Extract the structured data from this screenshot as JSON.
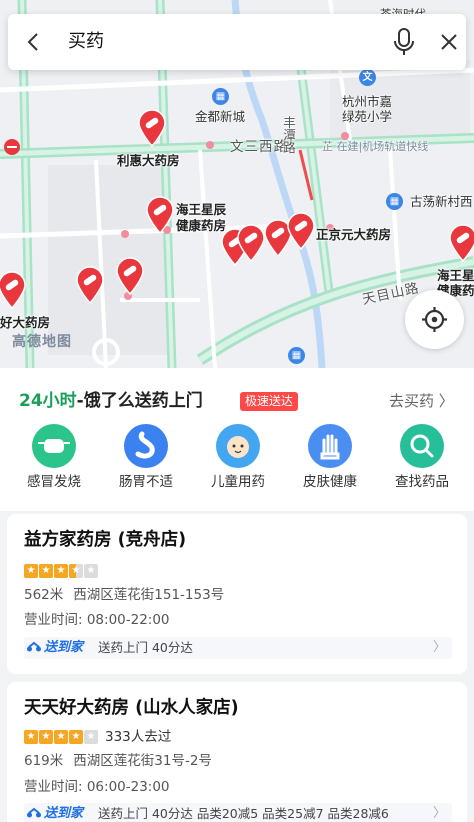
{
  "search": {
    "query": "买药"
  },
  "map": {
    "road_labels": [
      "文三西路",
      "丰潭路",
      "天目山路",
      "古荡新村西"
    ],
    "place_labels": [
      "金都新城",
      "杭州市嘉",
      "绿苑小学",
      "芷 在建|机场轨道快线",
      "茶海时代"
    ],
    "pois": [
      {
        "name": "利惠大药房"
      },
      {
        "name_line1": "海王星辰",
        "name_line2": "健康药房"
      },
      {
        "name": "正京元大药房"
      },
      {
        "name_line1": "海王星",
        "name_line2": "健康药"
      },
      {
        "name": "好大药房"
      }
    ],
    "watermark": "高德地图"
  },
  "promo": {
    "title_accent": "24小时",
    "title_rest": "-饿了么送药上门",
    "badge": "极速送达",
    "link": "去买药 〉",
    "categories": [
      {
        "label": "感冒发烧",
        "icon": "mask-icon",
        "color": "#2bc48a"
      },
      {
        "label": "肠胃不适",
        "icon": "stomach-icon",
        "color": "#3b82f0"
      },
      {
        "label": "儿童用药",
        "icon": "baby-icon",
        "color": "#42a6f0"
      },
      {
        "label": "皮肤健康",
        "icon": "hand-icon",
        "color": "#4a8ef2"
      },
      {
        "label": "查找药品",
        "icon": "magnifier-icon",
        "color": "#27bf9a"
      }
    ]
  },
  "cards": [
    {
      "name": "益方家药房 (竞舟店)",
      "rating": 3.5,
      "distance": "562米",
      "address": "西湖区莲花街151-153号",
      "hours": "营业时间: 08:00-22:00",
      "delivery_logo": "送到家",
      "delivery_text": "送药上门 40分达"
    },
    {
      "name": "天天好大药房 (山水人家店)",
      "rating": 4,
      "visits": "333人去过",
      "distance": "619米",
      "address": "西湖区莲花街31号-2号",
      "hours": "营业时间: 06:00-23:00",
      "delivery_logo": "送到家",
      "delivery_text": "送药上门 40分达 品类20减5 品类25减7 品类28减6"
    }
  ],
  "colors": {
    "accent_green": "#18a058",
    "badge_red": "#ff4848",
    "pin_red": "#e8383d",
    "road_green": "#9fe0c0"
  }
}
